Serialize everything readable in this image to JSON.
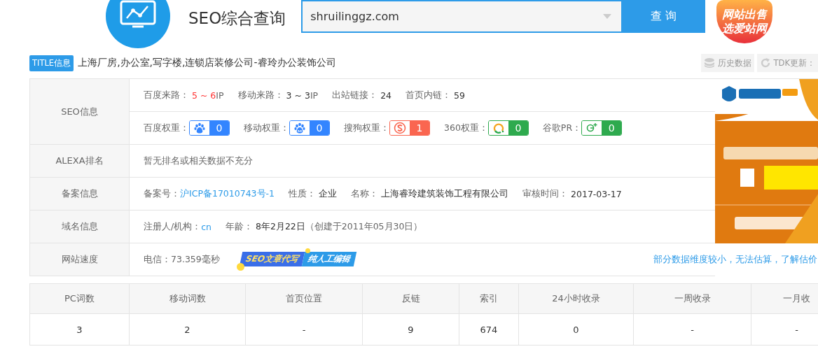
{
  "header": {
    "title": "SEO综合查询",
    "search": {
      "value": "shruilinggz.com"
    },
    "search_button": "查 询",
    "promo_logo": [
      "网站出售",
      "选爱站网"
    ]
  },
  "title_info": {
    "badge": "TITLE信息",
    "text": "上海厂房,办公室,写字楼,连锁店装修公司-睿玲办公装饰公司",
    "buttons": [
      {
        "label": "历史数据",
        "kind": "history"
      },
      {
        "label": "TDK更新：",
        "kind": "refresh"
      }
    ]
  },
  "info_rows": [
    {
      "label": "SEO信息",
      "lines": [
        [
          {
            "kind": "pair",
            "key": "百度来路：",
            "value": "5 ~ 6",
            "unit": " IP",
            "color": "#ff3333"
          },
          {
            "kind": "pair",
            "key": "移动来路：",
            "value": "3 ~ 3",
            "unit": " IP",
            "color": "#333333"
          },
          {
            "kind": "pair",
            "key": "出站链接：",
            "value": "24",
            "color": "#333333"
          },
          {
            "kind": "pair",
            "key": "首页内链：",
            "value": "59",
            "color": "#333333"
          }
        ],
        [
          {
            "kind": "baidu",
            "key": "百度权重：",
            "value": "0",
            "color": "#3385ff"
          },
          {
            "kind": "baidumobile",
            "key": "移动权重：",
            "value": "0",
            "color": "#3385ff"
          },
          {
            "kind": "sogou",
            "key": "搜狗权重：",
            "value": "1",
            "color": "#fa6650"
          },
          {
            "kind": "so360",
            "key": "360权重：",
            "value": "0",
            "color": "#2eaa4e"
          },
          {
            "kind": "google",
            "key": "谷歌PR：",
            "value": "0",
            "color": "#2eaa4e"
          }
        ]
      ]
    },
    {
      "label": "ALEXA排名",
      "lines": [
        [
          {
            "kind": "note",
            "text": "暂无排名或相关数据不充分"
          }
        ]
      ]
    },
    {
      "label": "备案信息",
      "lines": [
        [
          {
            "kind": "link",
            "key": "备案号：",
            "value": "沪ICP备17010743号-1"
          },
          {
            "kind": "pair",
            "key": "性质：",
            "value": "企业",
            "color": "#333333"
          },
          {
            "kind": "pair",
            "key": "名称：",
            "value": "上海睿玲建筑装饰工程有限公司",
            "color": "#333333"
          },
          {
            "kind": "pair",
            "key": "审核时间：",
            "value": "2017-03-17",
            "color": "#333333"
          }
        ]
      ]
    },
    {
      "label": "域名信息",
      "lines": [
        [
          {
            "kind": "link",
            "key": "注册人/机构：",
            "value": "cn"
          },
          {
            "kind": "pair",
            "key": "年龄：",
            "value": "8年2月22日",
            "unit": "（创建于2011年05月30日）",
            "color": "#333333"
          }
        ]
      ]
    },
    {
      "label": "网站速度",
      "lines": [
        [
          {
            "kind": "note",
            "text": "电信：73.359毫秒"
          },
          {
            "kind": "banner",
            "parts": [
              "SEO文章代写",
              "纯人工编辑"
            ]
          },
          {
            "kind": "hint",
            "text": "部分数据维度较小，无法估算，了解估价"
          }
        ]
      ]
    }
  ],
  "stats": {
    "columns": [
      "PC词数",
      "移动词数",
      "首页位置",
      "反链",
      "索引",
      "24小时收录",
      "一周收录",
      "一月收"
    ],
    "values": [
      "3",
      "2",
      "-",
      "9",
      "674",
      "0",
      "-",
      "-"
    ]
  }
}
